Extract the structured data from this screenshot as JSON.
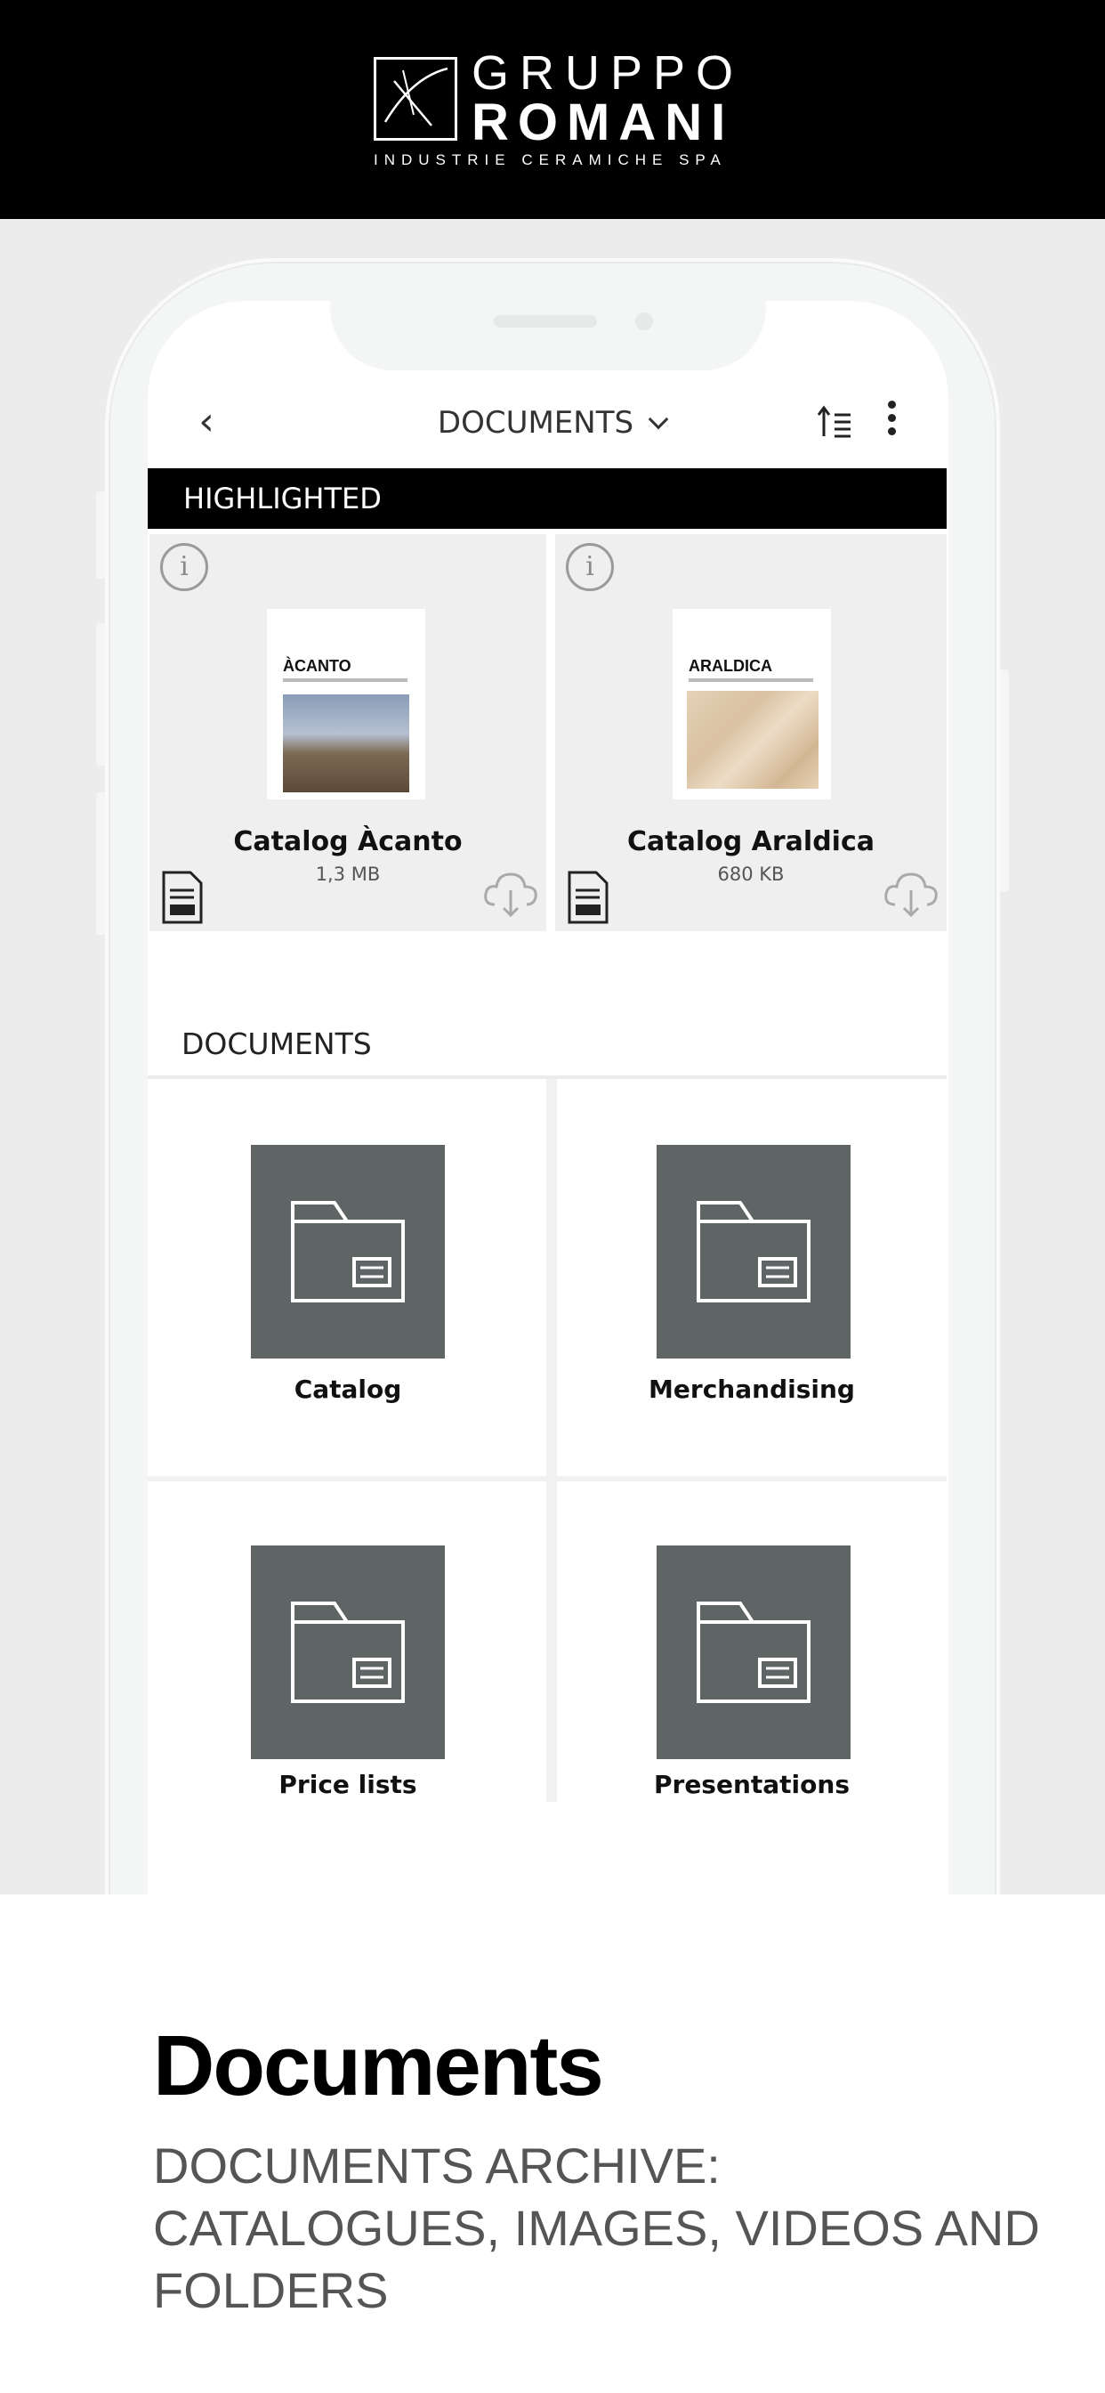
{
  "brand": {
    "line1": "GRUPPO",
    "line2": "ROMANI",
    "tagline": "INDUSTRIE CERAMICHE SPA"
  },
  "header": {
    "back_icon": "chevron-left-icon",
    "title": "DOCUMENTS",
    "dropdown_icon": "chevron-down-icon",
    "sort_icon": "sort-icon",
    "more_icon": "more-vertical-icon"
  },
  "highlighted": {
    "label": "HIGHLIGHTED",
    "items": [
      {
        "cover_title": "ÀCANTO",
        "name": "Catalog Àcanto",
        "size": "1,3 MB"
      },
      {
        "cover_title": "ARALDICA",
        "name": "Catalog Araldica",
        "size": "680 KB"
      }
    ]
  },
  "documents": {
    "label": "DOCUMENTS",
    "folders": [
      {
        "name": "Catalog"
      },
      {
        "name": "Merchandising"
      },
      {
        "name": "Price lists"
      },
      {
        "name": "Presentations"
      }
    ]
  },
  "caption": {
    "title": "Documents",
    "subtitle": "DOCUMENTS ARCHIVE: CATALOGUES, IMAGES, VIDEOS AND FOLDERS"
  },
  "colors": {
    "header_bg": "#000000",
    "folder_tile": "#5f6464",
    "card_bg": "#efefef",
    "page_bg": "#ececec"
  }
}
